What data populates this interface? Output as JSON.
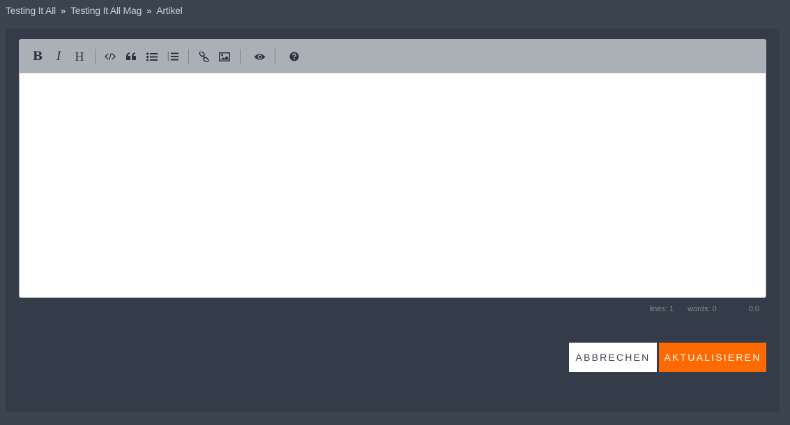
{
  "breadcrumb": {
    "items": [
      "Testing It All",
      "Testing It All Mag",
      "Artikel"
    ],
    "separator": "»"
  },
  "toolbar": {
    "buttons": [
      {
        "name": "bold",
        "icon": "bold-icon",
        "glyph": "B"
      },
      {
        "name": "italic",
        "icon": "italic-icon",
        "glyph": "I"
      },
      {
        "name": "heading",
        "icon": "heading-icon",
        "glyph": "H"
      },
      {
        "name": "code",
        "icon": "code-icon"
      },
      {
        "name": "quote",
        "icon": "quote-icon"
      },
      {
        "name": "unordered-list",
        "icon": "unordered-list-icon"
      },
      {
        "name": "ordered-list",
        "icon": "ordered-list-icon"
      },
      {
        "name": "link",
        "icon": "link-icon"
      },
      {
        "name": "image",
        "icon": "image-icon"
      },
      {
        "name": "preview",
        "icon": "eye-icon"
      },
      {
        "name": "guide",
        "icon": "question-circle-icon"
      }
    ]
  },
  "editor": {
    "content": ""
  },
  "status": {
    "lines": "lines: 1",
    "words": "words: 0",
    "cursor": "0:0"
  },
  "actions": {
    "cancel_label": "ABBRECHEN",
    "update_label": "AKTUALISIEREN"
  },
  "colors": {
    "page_bg": "#3b444f",
    "panel_bg": "#333c48",
    "toolbar_bg": "#aab0b6",
    "accent": "#ff6a00"
  }
}
